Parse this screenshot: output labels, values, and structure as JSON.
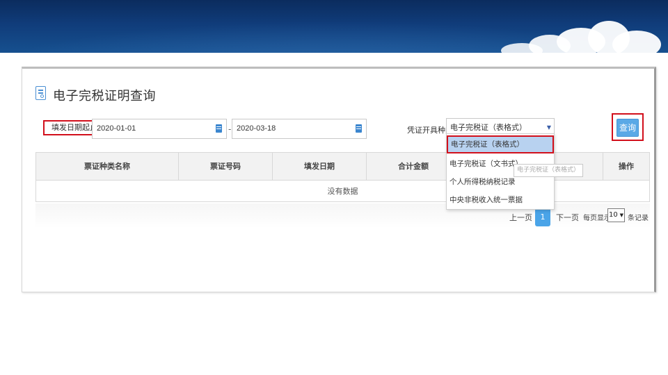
{
  "page": {
    "title": "电子完税证明查询",
    "filters": {
      "date_label": "填发日期起止：",
      "date_from": "2020-01-01",
      "date_separator": "-",
      "date_to": "2020-03-18",
      "type_label": "凭证开具种类：",
      "type_value": "电子完税证（表格式）",
      "query_label": "查询"
    },
    "table": {
      "columns": [
        "票证种类名称",
        "票证号码",
        "填发日期",
        "合计金额",
        "",
        "操作"
      ],
      "empty_text": "没有数据"
    },
    "pagination": {
      "prev": "上一页",
      "current": "1",
      "next": "下一页",
      "per_page_label": "每页显示",
      "page_size": "10",
      "records_label": "条记录"
    },
    "dropdown": {
      "options": [
        "电子完税证（表格式）",
        "电子完税证（文书式）",
        "个人所得税纳税记录",
        "中央非税收入统一票据"
      ],
      "selected_index": 0,
      "tooltip": "电子完税证（表格式）"
    }
  },
  "colors": {
    "banner": "#103c7a",
    "accent": "#4aa4e8",
    "highlight_border": "#d20f1b",
    "selected_option": "#b8d2f0"
  }
}
